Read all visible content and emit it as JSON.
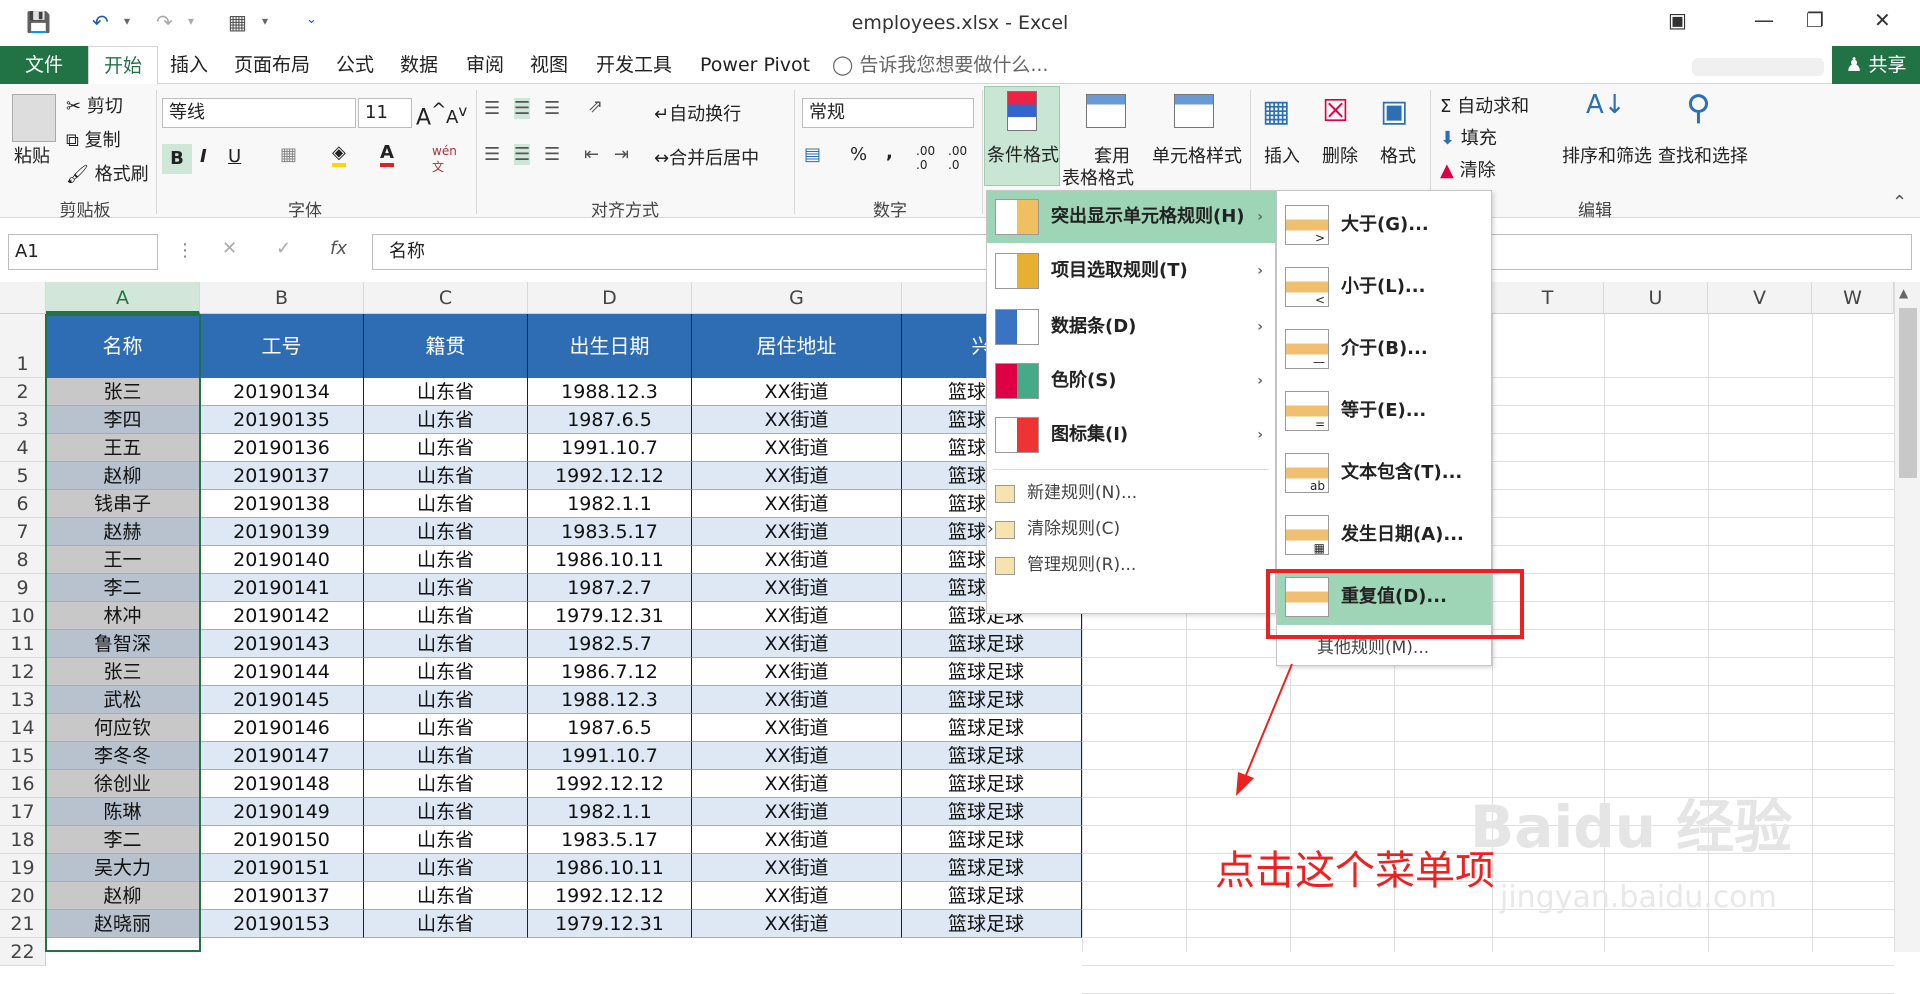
{
  "window": {
    "title": "employees.xlsx - Excel",
    "share": "共享"
  },
  "tabs": [
    "文件",
    "开始",
    "插入",
    "页面布局",
    "公式",
    "数据",
    "审阅",
    "视图",
    "开发工具",
    "Power Pivot"
  ],
  "tell_me": "告诉我您想要做什么...",
  "ribbon": {
    "clipboard": {
      "paste": "粘贴",
      "cut": "剪切",
      "copy": "复制",
      "format_painter": "格式刷",
      "label": "剪贴板"
    },
    "font": {
      "name": "等线",
      "size": "11",
      "label": "字体",
      "wen": "wén\n文"
    },
    "align": {
      "wrap": "自动换行",
      "merge": "合并后居中",
      "label": "对齐方式"
    },
    "number": {
      "format": "常规",
      "label": "数字",
      "percent": "%",
      "comma": ","
    },
    "styles": {
      "cond": "条件格式",
      "table1": "套用",
      "table2": "表格格式",
      "cell": "单元格样式"
    },
    "cells": {
      "insert": "插入",
      "delete": "删除",
      "format": "格式"
    },
    "editing": {
      "autosum": "自动求和",
      "fill": "填充",
      "clear": "清除",
      "sort": "排序和筛选",
      "find": "查找和选择",
      "label": "编辑"
    }
  },
  "formula_bar": {
    "name_box": "A1",
    "value": "名称",
    "fx": "fx"
  },
  "columns": [
    "A",
    "B",
    "C",
    "D",
    "G",
    "",
    "",
    "",
    "",
    "T",
    "U",
    "V",
    "W"
  ],
  "headers": [
    "名称",
    "工号",
    "籍贯",
    "出生日期",
    "居住地址",
    "兴趣"
  ],
  "rows": [
    [
      "张三",
      "20190134",
      "山东省",
      "1988.12.3",
      "XX街道",
      "篮球"
    ],
    [
      "李四",
      "20190135",
      "山东省",
      "1987.6.5",
      "XX街道",
      "篮球"
    ],
    [
      "王五",
      "20190136",
      "山东省",
      "1991.10.7",
      "XX街道",
      "篮球"
    ],
    [
      "赵柳",
      "20190137",
      "山东省",
      "1992.12.12",
      "XX街道",
      "篮球"
    ],
    [
      "钱串子",
      "20190138",
      "山东省",
      "1982.1.1",
      "XX街道",
      "篮球"
    ],
    [
      "赵赫",
      "20190139",
      "山东省",
      "1983.5.17",
      "XX街道",
      "篮球"
    ],
    [
      "王一",
      "20190140",
      "山东省",
      "1986.10.11",
      "XX街道",
      "篮球"
    ],
    [
      "李二",
      "20190141",
      "山东省",
      "1987.2.7",
      "XX街道",
      "篮球"
    ],
    [
      "林冲",
      "20190142",
      "山东省",
      "1979.12.31",
      "XX街道",
      "篮球足球"
    ],
    [
      "鲁智深",
      "20190143",
      "山东省",
      "1982.5.7",
      "XX街道",
      "篮球足球"
    ],
    [
      "张三",
      "20190144",
      "山东省",
      "1986.7.12",
      "XX街道",
      "篮球足球"
    ],
    [
      "武松",
      "20190145",
      "山东省",
      "1988.12.3",
      "XX街道",
      "篮球足球"
    ],
    [
      "何应钦",
      "20190146",
      "山东省",
      "1987.6.5",
      "XX街道",
      "篮球足球"
    ],
    [
      "李冬冬",
      "20190147",
      "山东省",
      "1991.10.7",
      "XX街道",
      "篮球足球"
    ],
    [
      "徐创业",
      "20190148",
      "山东省",
      "1992.12.12",
      "XX街道",
      "篮球足球"
    ],
    [
      "陈琳",
      "20190149",
      "山东省",
      "1982.1.1",
      "XX街道",
      "篮球足球"
    ],
    [
      "李二",
      "20190150",
      "山东省",
      "1983.5.17",
      "XX街道",
      "篮球足球"
    ],
    [
      "吴大力",
      "20190151",
      "山东省",
      "1986.10.11",
      "XX街道",
      "篮球足球"
    ],
    [
      "赵柳",
      "20190137",
      "山东省",
      "1992.12.12",
      "XX街道",
      "篮球足球"
    ],
    [
      "赵晓丽",
      "20190153",
      "山东省",
      "1979.12.31",
      "XX街道",
      "篮球足球"
    ]
  ],
  "menu": [
    {
      "label": "突出显示单元格规则(H)",
      "highlight": true
    },
    {
      "label": "项目选取规则(T)"
    },
    {
      "label": "数据条(D)"
    },
    {
      "label": "色阶(S)"
    },
    {
      "label": "图标集(I)"
    }
  ],
  "menu_small": [
    "新建规则(N)...",
    "清除规则(C)",
    "管理规则(R)..."
  ],
  "submenu": [
    "大于(G)...",
    "小于(L)...",
    "介于(B)...",
    "等于(E)...",
    "文本包含(T)...",
    "发生日期(A)...",
    "重复值(D)..."
  ],
  "submenu_more": "其他规则(M)...",
  "annotation": "点击这个菜单项",
  "watermark": "Baidu 经验",
  "watermark_url": "jingyan.baidu.com",
  "colors": {
    "excel_green": "#217346",
    "header_blue": "#2e6db4",
    "menu_hover": "#9fd5b7",
    "annot_red": "#ee2020"
  }
}
